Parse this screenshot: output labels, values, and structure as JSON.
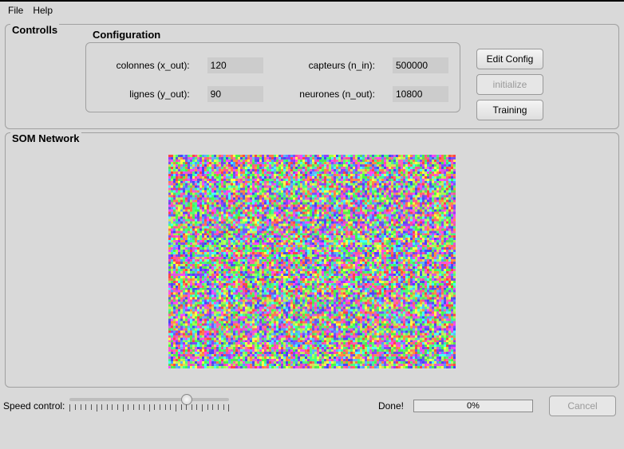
{
  "menu": {
    "file": "File",
    "help": "Help"
  },
  "panels": {
    "controls_title": "Controlls",
    "som_title": "SOM Network"
  },
  "config": {
    "title": "Configuration",
    "fields": {
      "x_out_label": "colonnes (x_out):",
      "x_out_value": "120",
      "n_in_label": "capteurs (n_in):",
      "n_in_value": "500000",
      "y_out_label": "lignes (y_out):",
      "y_out_value": "90",
      "n_out_label": "neurones (n_out):",
      "n_out_value": "10800"
    }
  },
  "buttons": {
    "edit_config": "Edit Config",
    "initialize": "initialize",
    "training": "Training",
    "cancel": "Cancel"
  },
  "bottom": {
    "speed_label": "Speed control:",
    "speed_value": 75,
    "done_label": "Done!",
    "progress_pct": "0%",
    "progress_value": 0
  },
  "som": {
    "cols": 120,
    "rows": 90
  }
}
